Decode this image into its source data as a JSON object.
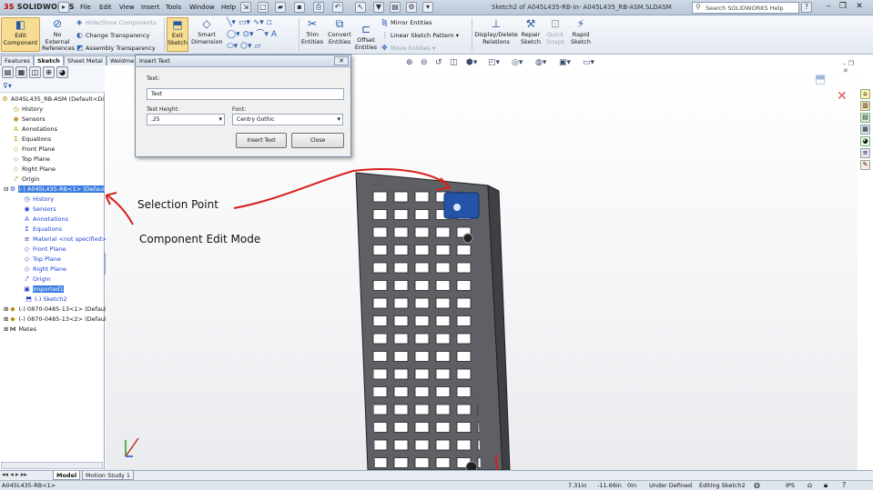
{
  "app": {
    "brand": "SOLIDWORKS",
    "brand_prefix": "3S",
    "doc_title": "Sketch2 of A045L435-RB-in- A045L435_RB-ASM.SLDASM"
  },
  "menu": [
    "File",
    "Edit",
    "View",
    "Insert",
    "Tools",
    "Window",
    "Help"
  ],
  "search": {
    "placeholder": "Search SOLIDWORKS Help"
  },
  "ribbon": {
    "edit_component": "Edit Component",
    "no_external_references": "No External References",
    "hide_show_components": "Hide/Show Components",
    "change_transparency": "Change Transparency",
    "assembly_transparency": "Assembly Transparency",
    "exit_sketch": "Exit Sketch",
    "smart_dimension": "Smart Dimension",
    "trim_entities": "Trim Entities",
    "convert_entities": "Convert Entities",
    "offset_entities": "Offset Entities",
    "mirror_entities": "Mirror Entities",
    "linear_sketch_pattern": "Linear Sketch Pattern",
    "move_entities": "Move Entities",
    "display_delete_relations": "Display/Delete Relations",
    "repair_sketch": "Repair Sketch",
    "quick_snaps": "Quick Snaps",
    "rapid_sketch": "Rapid Sketch"
  },
  "tabs": [
    "Features",
    "Sketch",
    "Sheet Metal",
    "Weldme"
  ],
  "tree": {
    "root": "A045L435_RB-ASM (Default<Di",
    "top_items": [
      "History",
      "Sensors",
      "Annotations",
      "Equations",
      "Front Plane",
      "Top Plane",
      "Right Plane",
      "Origin"
    ],
    "component": "(-) A045L435-RB<1> (Defaul",
    "component_items": [
      "History",
      "Sensors",
      "Annotations",
      "Equations",
      "Material <not specified>",
      "Front Plane",
      "Top Plane",
      "Right Plane",
      "Origin",
      "Imported1"
    ],
    "sketch": "(-) Sketch2",
    "parts": [
      "(-) 0870-0485-13<1> (Defaul",
      "(-) 0870-0485-13<2> (Defaul"
    ],
    "mates": "Mates"
  },
  "dialog": {
    "title": "Insert Text",
    "text_label": "Text:",
    "text_value": "Text",
    "height_label": "Text Height:",
    "height_value": ".25",
    "font_label": "Font:",
    "font_value": "Centry Gothic",
    "insert_button": "Insert Text",
    "close_button": "Close"
  },
  "annotations": {
    "selection_point": "Selection Point",
    "component_edit_mode": "Component Edit Mode"
  },
  "bottom_tabs": [
    "Model",
    "Motion Study 1"
  ],
  "status": {
    "component": "A045L435-RB<1>",
    "x": "7.31in",
    "y": "-11.66in",
    "z": "0in",
    "state": "Under Defined",
    "editing": "Editing Sketch2",
    "units": "IPS"
  },
  "colors": {
    "annotation_red": "#d8201c",
    "edit_highlight": "#f6dd93",
    "tree_blue": "#1b3fd4",
    "selection_blue": "#3b7de0"
  }
}
